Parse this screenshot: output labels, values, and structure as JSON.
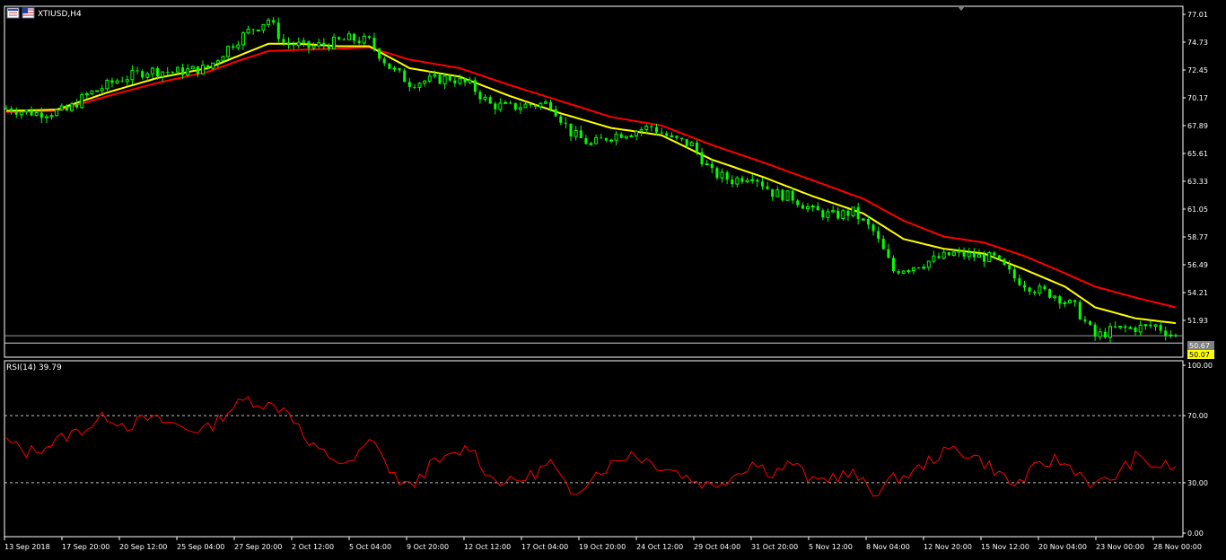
{
  "window": {
    "symbol_label": "XTIUSD,H4",
    "flag_icon": "us-flag-icon",
    "chart_icon": "chart-window-icon"
  },
  "colors": {
    "background": "#000000",
    "frame": "#ffffff",
    "bull_candle": "#00ff00",
    "bear_candle": "#00ff00",
    "ma_fast": "#ffff00",
    "ma_slow": "#ff0000",
    "rsi_line": "#ff0000",
    "rsi_levels": "#c0c0c0",
    "last_price_bg": "#ffff00",
    "bid_bg": "#808080"
  },
  "indicators": {
    "rsi_label": "RSI(14) 39.79"
  },
  "price_badges": {
    "bid": "50.67",
    "last": "50.07"
  },
  "chart_data": [
    {
      "type": "candlestick",
      "symbol": "XTIUSD",
      "timeframe": "H4",
      "ylim": [
        50.0,
        77.01
      ],
      "yticks": [
        "77.01",
        "74.73",
        "72.45",
        "70.17",
        "67.89",
        "65.61",
        "63.33",
        "61.05",
        "58.77",
        "56.49",
        "54.21",
        "51.93"
      ],
      "x_tick_labels": [
        "13 Sep 2018",
        "17 Sep 20:00",
        "20 Sep 12:00",
        "25 Sep 04:00",
        "27 Sep 20:00",
        "2 Oct 12:00",
        "5 Oct 04:00",
        "9 Oct 20:00",
        "12 Oct 12:00",
        "17 Oct 04:00",
        "19 Oct 20:00",
        "24 Oct 12:00",
        "29 Oct 04:00",
        "31 Oct 20:00",
        "5 Nov 12:00",
        "8 Nov 04:00",
        "12 Nov 20:00",
        "15 Nov 12:00",
        "20 Nov 04:00",
        "23 Nov 00:00",
        "28 Nov 00:00"
      ],
      "close_path": [
        [
          0,
          69.3
        ],
        [
          6,
          68.9
        ],
        [
          12,
          69.1
        ],
        [
          16,
          70.4
        ],
        [
          22,
          71.6
        ],
        [
          28,
          72.4
        ],
        [
          34,
          72.3
        ],
        [
          40,
          72.6
        ],
        [
          44,
          74.3
        ],
        [
          48,
          75.6
        ],
        [
          52,
          76.6
        ],
        [
          55,
          74.7
        ],
        [
          60,
          74.3
        ],
        [
          64,
          74.6
        ],
        [
          68,
          75.0
        ],
        [
          72,
          74.8
        ],
        [
          76,
          72.7
        ],
        [
          80,
          71.4
        ],
        [
          84,
          71.6
        ],
        [
          88,
          71.8
        ],
        [
          92,
          71.2
        ],
        [
          96,
          69.6
        ],
        [
          100,
          69.4
        ],
        [
          104,
          69.6
        ],
        [
          108,
          69.7
        ],
        [
          112,
          67.3
        ],
        [
          116,
          66.3
        ],
        [
          120,
          67.1
        ],
        [
          124,
          67.4
        ],
        [
          128,
          67.8
        ],
        [
          132,
          66.8
        ],
        [
          136,
          66.3
        ],
        [
          140,
          64.0
        ],
        [
          144,
          63.4
        ],
        [
          148,
          63.9
        ],
        [
          152,
          62.4
        ],
        [
          156,
          62.0
        ],
        [
          160,
          60.9
        ],
        [
          164,
          60.5
        ],
        [
          168,
          60.8
        ],
        [
          172,
          59.2
        ],
        [
          176,
          56.0
        ],
        [
          180,
          56.4
        ],
        [
          184,
          56.9
        ],
        [
          188,
          57.4
        ],
        [
          192,
          57.2
        ],
        [
          196,
          57.0
        ],
        [
          200,
          55.4
        ],
        [
          204,
          54.5
        ],
        [
          208,
          54.0
        ],
        [
          212,
          53.0
        ],
        [
          216,
          50.6
        ],
        [
          220,
          51.2
        ],
        [
          224,
          51.3
        ],
        [
          228,
          51.5
        ],
        [
          232,
          50.6
        ]
      ],
      "ma_fast_path": [
        [
          0,
          69.1
        ],
        [
          10,
          69.2
        ],
        [
          20,
          70.6
        ],
        [
          30,
          71.8
        ],
        [
          40,
          72.6
        ],
        [
          46,
          73.6
        ],
        [
          52,
          74.6
        ],
        [
          58,
          74.6
        ],
        [
          66,
          74.4
        ],
        [
          72,
          74.4
        ],
        [
          80,
          72.6
        ],
        [
          90,
          71.9
        ],
        [
          100,
          70.3
        ],
        [
          110,
          68.9
        ],
        [
          120,
          67.7
        ],
        [
          130,
          67.1
        ],
        [
          140,
          65.1
        ],
        [
          150,
          63.7
        ],
        [
          160,
          62.1
        ],
        [
          170,
          60.7
        ],
        [
          178,
          58.6
        ],
        [
          186,
          57.8
        ],
        [
          194,
          57.4
        ],
        [
          202,
          56.1
        ],
        [
          210,
          54.7
        ],
        [
          216,
          53.0
        ],
        [
          224,
          52.1
        ],
        [
          232,
          51.7
        ]
      ],
      "ma_slow_path": [
        [
          0,
          69.0
        ],
        [
          10,
          69.1
        ],
        [
          20,
          70.3
        ],
        [
          30,
          71.4
        ],
        [
          40,
          72.3
        ],
        [
          46,
          73.2
        ],
        [
          52,
          74.0
        ],
        [
          58,
          74.1
        ],
        [
          66,
          74.2
        ],
        [
          72,
          74.3
        ],
        [
          80,
          73.3
        ],
        [
          90,
          72.6
        ],
        [
          100,
          71.2
        ],
        [
          110,
          69.9
        ],
        [
          120,
          68.6
        ],
        [
          130,
          67.9
        ],
        [
          140,
          66.3
        ],
        [
          150,
          64.9
        ],
        [
          160,
          63.4
        ],
        [
          170,
          61.9
        ],
        [
          178,
          60.1
        ],
        [
          186,
          58.8
        ],
        [
          194,
          58.3
        ],
        [
          202,
          57.2
        ],
        [
          210,
          55.8
        ],
        [
          216,
          54.7
        ],
        [
          224,
          53.8
        ],
        [
          232,
          53.0
        ]
      ],
      "horizontal_levels": [
        50.67,
        50.07
      ]
    },
    {
      "type": "line",
      "name": "RSI(14)",
      "ylim": [
        0,
        100
      ],
      "yticks": [
        "100.00",
        "70.00",
        "30.00",
        "0.00"
      ],
      "levels": [
        70,
        30
      ],
      "values_path": [
        [
          0,
          55
        ],
        [
          4,
          48
        ],
        [
          8,
          52
        ],
        [
          12,
          58
        ],
        [
          16,
          63
        ],
        [
          20,
          70
        ],
        [
          24,
          64
        ],
        [
          28,
          68
        ],
        [
          32,
          66
        ],
        [
          36,
          62
        ],
        [
          40,
          62
        ],
        [
          44,
          73
        ],
        [
          48,
          80
        ],
        [
          52,
          76
        ],
        [
          56,
          74
        ],
        [
          60,
          52
        ],
        [
          64,
          46
        ],
        [
          68,
          40
        ],
        [
          72,
          54
        ],
        [
          74,
          52
        ],
        [
          76,
          36
        ],
        [
          80,
          27
        ],
        [
          84,
          40
        ],
        [
          88,
          45
        ],
        [
          92,
          52
        ],
        [
          96,
          33
        ],
        [
          100,
          30
        ],
        [
          104,
          34
        ],
        [
          108,
          42
        ],
        [
          112,
          22
        ],
        [
          116,
          34
        ],
        [
          120,
          41
        ],
        [
          124,
          48
        ],
        [
          128,
          42
        ],
        [
          132,
          38
        ],
        [
          136,
          32
        ],
        [
          140,
          28
        ],
        [
          144,
          34
        ],
        [
          148,
          42
        ],
        [
          152,
          36
        ],
        [
          156,
          42
        ],
        [
          160,
          30
        ],
        [
          164,
          34
        ],
        [
          168,
          35
        ],
        [
          172,
          24
        ],
        [
          176,
          32
        ],
        [
          180,
          36
        ],
        [
          184,
          45
        ],
        [
          188,
          50
        ],
        [
          192,
          46
        ],
        [
          196,
          38
        ],
        [
          200,
          28
        ],
        [
          204,
          38
        ],
        [
          208,
          44
        ],
        [
          212,
          38
        ],
        [
          216,
          28
        ],
        [
          220,
          34
        ],
        [
          224,
          45
        ],
        [
          228,
          40
        ],
        [
          232,
          39.79
        ]
      ]
    }
  ]
}
